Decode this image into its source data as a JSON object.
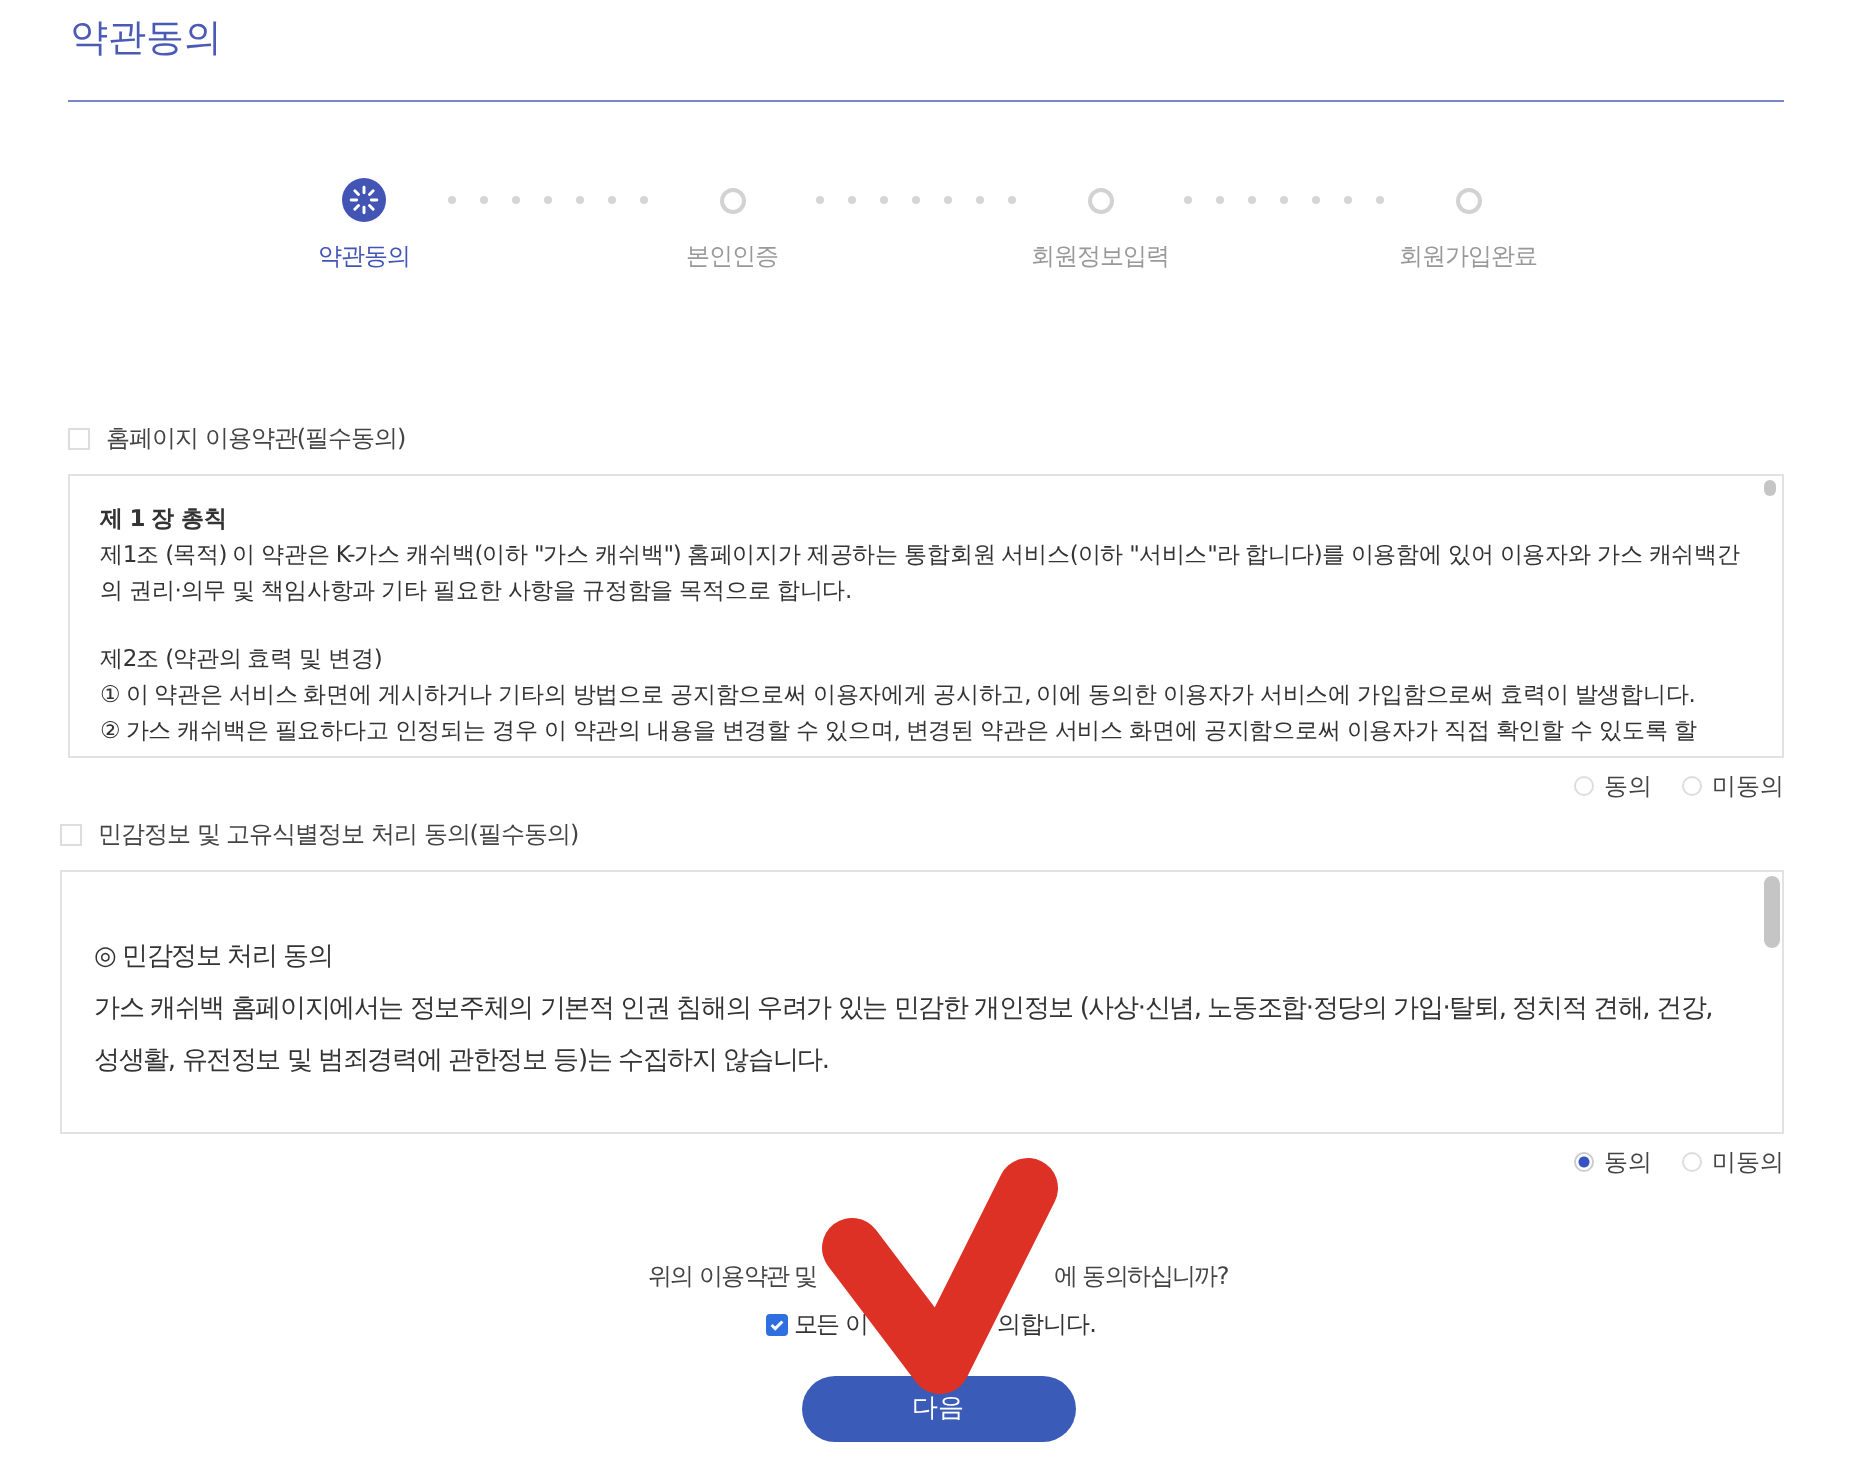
{
  "page": {
    "title": "약관동의"
  },
  "steps": [
    {
      "label": "약관동의",
      "selected": true
    },
    {
      "label": "본인인증",
      "selected": false
    },
    {
      "label": "회원정보입력",
      "selected": false
    },
    {
      "label": "회원가입완료",
      "selected": false
    }
  ],
  "agreements": [
    {
      "label": "홈페이지 이용약관(필수동의)",
      "checked": false,
      "paragraphs": [
        {
          "kind": "heading",
          "text": "제 1 장 총칙"
        },
        {
          "kind": "text",
          "text": "제1조 (목적) 이 약관은 K-가스 캐쉬백(이하 \"가스 캐쉬백\") 홈페이지가 제공하는 통합회원 서비스(이하 \"서비스\"라 합니다)를 이용함에 있어 이용자와 가스 캐쉬백간의 권리·의무 및 책임사항과 기타 필요한 사항을 규정함을 목적으로 합니다."
        },
        {
          "kind": "section",
          "text": "제2조 (약관의 효력 및 변경)"
        },
        {
          "kind": "text",
          "text": "① 이 약관은 서비스 화면에 게시하거나 기타의 방법으로 공지함으로써 이용자에게 공시하고, 이에 동의한 이용자가 서비스에 가입함으로써 효력이 발생합니다."
        },
        {
          "kind": "text",
          "text": "② 가스 캐쉬백은 필요하다고 인정되는 경우 이 약관의 내용을 변경할 수 있으며, 변경된 약관은 서비스 화면에 공지함으로써 이용자가 직접 확인할 수 있도록 할"
        }
      ],
      "options": [
        {
          "label": "동의",
          "selected": false
        },
        {
          "label": "미동의",
          "selected": false
        }
      ]
    },
    {
      "label": "민감정보 및 고유식별정보 처리 동의(필수동의)",
      "checked": false,
      "paragraphs": [
        {
          "kind": "text",
          "text": "◎ 민감정보 처리 동의"
        },
        {
          "kind": "text",
          "text": "가스 캐쉬백 홈페이지에서는 정보주체의 기본적 인권 침해의 우려가 있는 민감한 개인정보 (사상·신념, 노동조합·정당의 가입·탈퇴, 정치적 견해, 건강, 성생활, 유전정보 및 범죄경력에 관한정보 등)는 수집하지 않습니다."
        }
      ],
      "options": [
        {
          "label": "동의",
          "selected": true
        },
        {
          "label": "미동의",
          "selected": false
        }
      ]
    }
  ],
  "question": [
    "위의 이용약관 및",
    "에 동의하십니까?"
  ],
  "agree_all": {
    "checked": true,
    "label_parts": [
      "모든 이",
      "의합니다."
    ]
  },
  "next_button": "다음",
  "overlay": {
    "kind": "check-mark"
  }
}
